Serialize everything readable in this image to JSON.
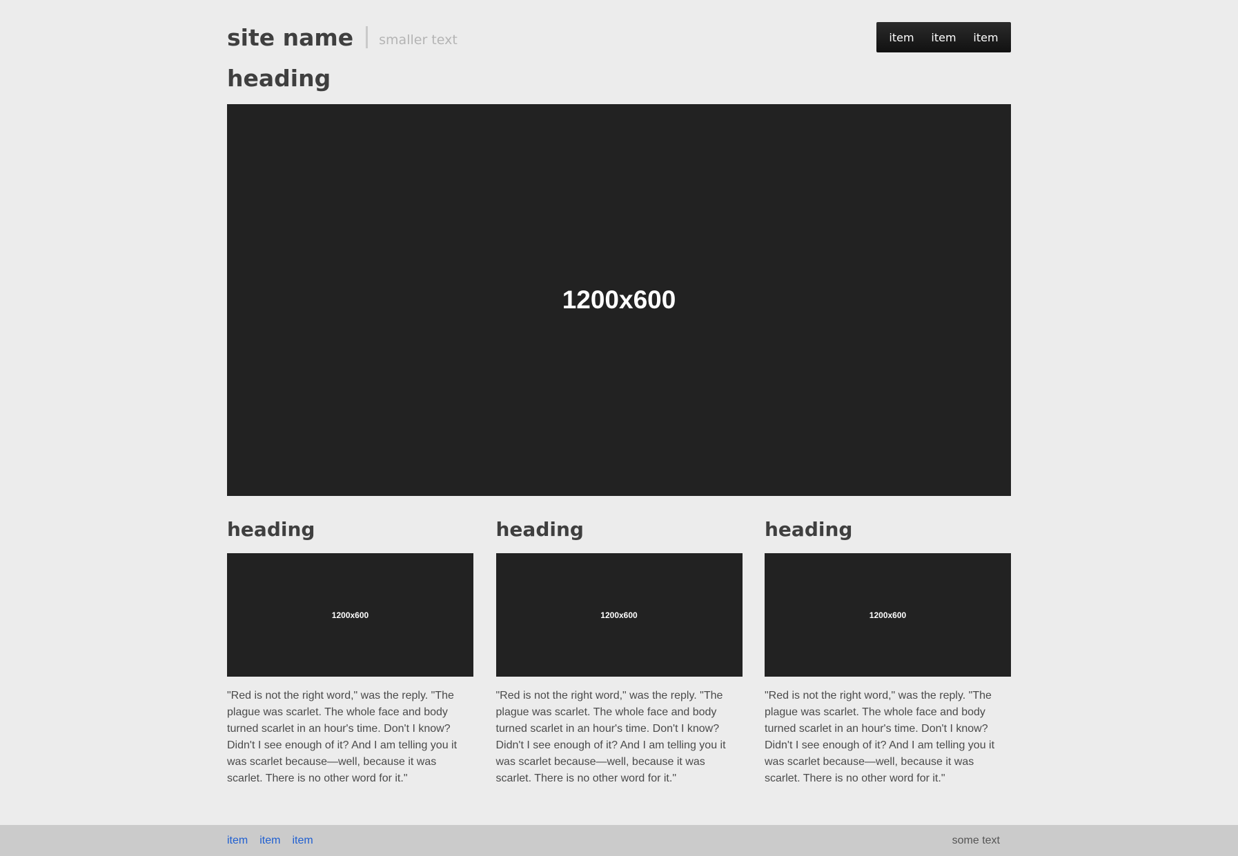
{
  "header": {
    "site_name": "site name",
    "tagline": "smaller text",
    "nav": [
      "item",
      "item",
      "item"
    ]
  },
  "main": {
    "heading": "heading",
    "hero_label": "1200x600"
  },
  "columns": [
    {
      "heading": "heading",
      "image_label": "1200x600",
      "text": "\"Red is not the right word,\" was the reply. \"The plague was scarlet. The whole face and body turned scarlet in an hour's time. Don't I know? Didn't I see enough of it? And I am telling you it was scarlet because—well, because it was scarlet. There is no other word for it.\""
    },
    {
      "heading": "heading",
      "image_label": "1200x600",
      "text": "\"Red is not the right word,\" was the reply. \"The plague was scarlet. The whole face and body turned scarlet in an hour's time. Don't I know? Didn't I see enough of it? And I am telling you it was scarlet because—well, because it was scarlet. There is no other word for it.\""
    },
    {
      "heading": "heading",
      "image_label": "1200x600",
      "text": "\"Red is not the right word,\" was the reply. \"The plague was scarlet. The whole face and body turned scarlet in an hour's time. Don't I know? Didn't I see enough of it? And I am telling you it was scarlet because—well, because it was scarlet. There is no other word for it.\""
    }
  ],
  "footer": {
    "links": [
      "item",
      "item",
      "item"
    ],
    "text": "some text"
  },
  "colors": {
    "background": "#ececec",
    "placeholder": "#222222",
    "nav_bg": "#1a1a1a",
    "footer_bg": "#cbcbcb",
    "link": "#1f5fd1"
  }
}
